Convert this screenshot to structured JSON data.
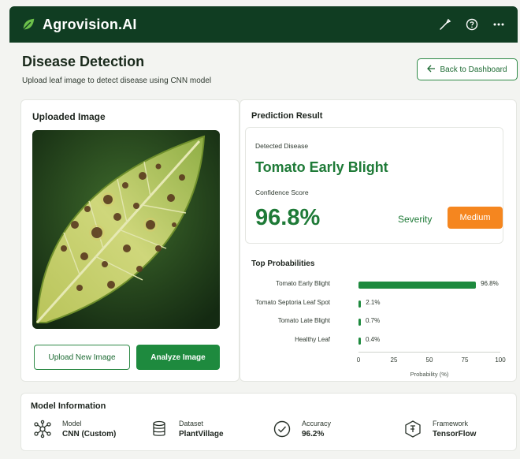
{
  "app": {
    "title": "Agrovision.AI",
    "logo_icon": "leaf-icon"
  },
  "topbar": {
    "icons": [
      "pen-icon",
      "help-circle-icon",
      "more-icon"
    ]
  },
  "page": {
    "title": "Disease Detection",
    "subtitle": "Upload leaf image to detect disease using CNN model",
    "back_button": "Back to Dashboard"
  },
  "upload": {
    "title": "Uploaded Image",
    "upload_button": "Upload New Image",
    "analyze_button": "Analyze Image"
  },
  "prediction": {
    "title": "Prediction Result",
    "detected_label": "Detected Disease",
    "disease": "Tomato Early Blight",
    "confidence_label": "Confidence Score",
    "confidence": "96.8%",
    "severity_label": "Severity",
    "severity": "Medium",
    "severity_color": "#f5861f",
    "top_title": "Top Probabilities"
  },
  "chart_data": {
    "type": "bar",
    "orientation": "horizontal",
    "title": "Top Probabilities",
    "categories": [
      "Tomato Early Blight",
      "Tomato Septoria Leaf Spot",
      "Tomato Late Blight",
      "Healthy Leaf"
    ],
    "values": [
      96.8,
      2.1,
      0.7,
      0.4
    ],
    "value_labels": [
      "96.8%",
      "2.1%",
      "0.7%",
      "0.4%"
    ],
    "xlabel": "Probability (%)",
    "xlim": [
      0,
      100
    ],
    "ticks": [
      "0",
      "25",
      "50",
      "75",
      "100"
    ],
    "bar_color": "#1e8a3e"
  },
  "model_info": {
    "title": "Model Information",
    "items": [
      {
        "label": "Model",
        "value": "CNN (Custom)",
        "icon": "network-icon"
      },
      {
        "label": "Dataset",
        "value": "PlantVillage",
        "icon": "database-icon"
      },
      {
        "label": "Accuracy",
        "value": "96.2%",
        "icon": "check-circle-icon"
      },
      {
        "label": "Framework",
        "value": "TensorFlow",
        "icon": "framework-icon"
      }
    ]
  },
  "colors": {
    "header": "#103d22",
    "accent": "#1e7a37",
    "button": "#1e8a3e"
  }
}
